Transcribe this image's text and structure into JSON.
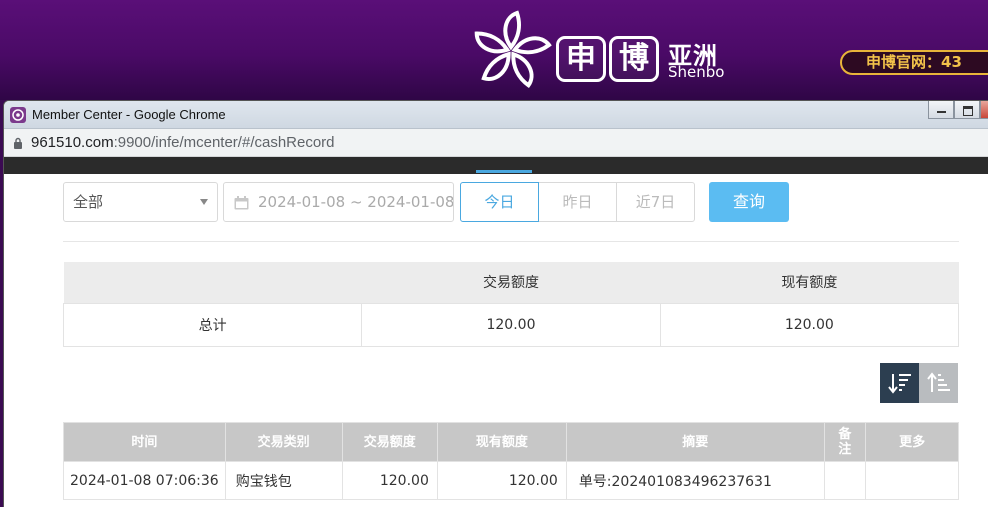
{
  "banner": {
    "logo_box1": "申",
    "logo_box2": "博",
    "logo_cn": "亚洲",
    "logo_en": "Shenbo",
    "official_text": "申博官网：43"
  },
  "browser": {
    "title": "Member Center - Google Chrome",
    "url_host": "961510.com",
    "url_path": ":9900/infe/mcenter/#/cashRecord"
  },
  "filter": {
    "type_select": "全部",
    "date_range": "2024-01-08 ~ 2024-01-08",
    "quick_ranges": [
      "今日",
      "昨日",
      "近7日"
    ],
    "active_range": "今日",
    "query_button": "查询"
  },
  "summary": {
    "headers": [
      "",
      "交易额度",
      "现有额度"
    ],
    "row": [
      "总计",
      "120.00",
      "120.00"
    ]
  },
  "records": {
    "headers": [
      "时间",
      "交易类别",
      "交易额度",
      "现有额度",
      "摘要",
      "备注",
      "更多"
    ],
    "rows": [
      [
        "2024-01-08 07:06:36",
        "购宝钱包",
        "120.00",
        "120.00",
        "单号:202401083496237631",
        "",
        ""
      ]
    ]
  },
  "colors": {
    "banner_purple": "#4a0a66",
    "accent_blue": "#4aa8e0",
    "query_button_blue": "#5bbcf2",
    "header_gray": "#c7c7c7"
  }
}
